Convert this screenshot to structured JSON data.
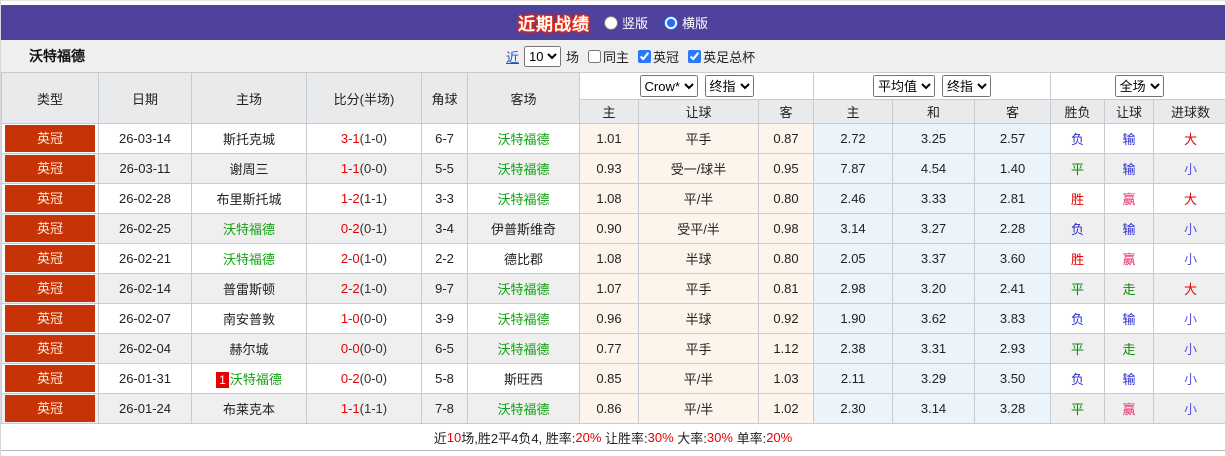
{
  "title_bar": {
    "title": "近期战绩",
    "radio_vertical_label": "竖版",
    "radio_horizontal_label": "横版",
    "selected_layout": "横版"
  },
  "team_bar": {
    "team": "沃特福德",
    "near_label": "近",
    "match_count": "10",
    "unit_label": "场",
    "checkbox_same_home": {
      "label": "同主",
      "checked": false
    },
    "checkbox_league": {
      "label": "英冠",
      "checked": true
    },
    "checkbox_cup": {
      "label": "英足总杯",
      "checked": true
    }
  },
  "table": {
    "headers": {
      "type": "类型",
      "date": "日期",
      "home": "主场",
      "score": "比分(半场)",
      "corners": "角球",
      "away": "客场"
    },
    "selects": {
      "odds_company": "Crow*",
      "final_odds_1": "终指",
      "average": "平均值",
      "final_odds_2": "终指",
      "scope": "全场"
    },
    "sub_headers": {
      "crow_home": "主",
      "crow_handicap": "让球",
      "crow_away": "客",
      "avg_home": "主",
      "avg_draw": "和",
      "avg_away": "客",
      "result_wdl": "胜负",
      "result_handicap": "让球",
      "result_goals": "进球数"
    },
    "rows": [
      {
        "league": "英冠",
        "date": "26-03-14",
        "home": "斯托克城",
        "home_self": false,
        "home_rank": "",
        "score_ft": "3-1",
        "score_ht": "(1-0)",
        "corners": "6-7",
        "away": "沃特福德",
        "away_self": true,
        "crow_home": "1.01",
        "handicap": "平手",
        "crow_away": "0.87",
        "avg_home": "2.72",
        "avg_draw": "3.25",
        "avg_away": "2.57",
        "wdl": "负",
        "wdl_k": "lose",
        "cover": "输",
        "cover_k": "lose",
        "goals": "大",
        "goals_k": "big"
      },
      {
        "league": "英冠",
        "date": "26-03-11",
        "home": "谢周三",
        "home_self": false,
        "home_rank": "",
        "score_ft": "1-1",
        "score_ht": "(0-0)",
        "corners": "5-5",
        "away": "沃特福德",
        "away_self": true,
        "crow_home": "0.93",
        "handicap": "受一/球半",
        "crow_away": "0.95",
        "avg_home": "7.87",
        "avg_draw": "4.54",
        "avg_away": "1.40",
        "wdl": "平",
        "wdl_k": "draw",
        "cover": "输",
        "cover_k": "lose",
        "goals": "小",
        "goals_k": "small"
      },
      {
        "league": "英冠",
        "date": "26-02-28",
        "home": "布里斯托城",
        "home_self": false,
        "home_rank": "",
        "score_ft": "1-2",
        "score_ht": "(1-1)",
        "corners": "3-3",
        "away": "沃特福德",
        "away_self": true,
        "crow_home": "1.08",
        "handicap": "平/半",
        "crow_away": "0.80",
        "avg_home": "2.46",
        "avg_draw": "3.33",
        "avg_away": "2.81",
        "wdl": "胜",
        "wdl_k": "win",
        "cover": "赢",
        "cover_k": "hwin",
        "goals": "大",
        "goals_k": "big"
      },
      {
        "league": "英冠",
        "date": "26-02-25",
        "home": "沃特福德",
        "home_self": true,
        "home_rank": "",
        "score_ft": "0-2",
        "score_ht": "(0-1)",
        "corners": "3-4",
        "away": "伊普斯维奇",
        "away_self": false,
        "crow_home": "0.90",
        "handicap": "受平/半",
        "crow_away": "0.98",
        "avg_home": "3.14",
        "avg_draw": "3.27",
        "avg_away": "2.28",
        "wdl": "负",
        "wdl_k": "lose",
        "cover": "输",
        "cover_k": "lose",
        "goals": "小",
        "goals_k": "small"
      },
      {
        "league": "英冠",
        "date": "26-02-21",
        "home": "沃特福德",
        "home_self": true,
        "home_rank": "",
        "score_ft": "2-0",
        "score_ht": "(1-0)",
        "corners": "2-2",
        "away": "德比郡",
        "away_self": false,
        "crow_home": "1.08",
        "handicap": "半球",
        "crow_away": "0.80",
        "avg_home": "2.05",
        "avg_draw": "3.37",
        "avg_away": "3.60",
        "wdl": "胜",
        "wdl_k": "win",
        "cover": "赢",
        "cover_k": "hwin",
        "goals": "小",
        "goals_k": "small"
      },
      {
        "league": "英冠",
        "date": "26-02-14",
        "home": "普雷斯顿",
        "home_self": false,
        "home_rank": "",
        "score_ft": "2-2",
        "score_ht": "(1-0)",
        "corners": "9-7",
        "away": "沃特福德",
        "away_self": true,
        "crow_home": "1.07",
        "handicap": "平手",
        "crow_away": "0.81",
        "avg_home": "2.98",
        "avg_draw": "3.20",
        "avg_away": "2.41",
        "wdl": "平",
        "wdl_k": "draw",
        "cover": "走",
        "cover_k": "draw",
        "goals": "大",
        "goals_k": "big"
      },
      {
        "league": "英冠",
        "date": "26-02-07",
        "home": "南安普敦",
        "home_self": false,
        "home_rank": "",
        "score_ft": "1-0",
        "score_ht": "(0-0)",
        "corners": "3-9",
        "away": "沃特福德",
        "away_self": true,
        "crow_home": "0.96",
        "handicap": "半球",
        "crow_away": "0.92",
        "avg_home": "1.90",
        "avg_draw": "3.62",
        "avg_away": "3.83",
        "wdl": "负",
        "wdl_k": "lose",
        "cover": "输",
        "cover_k": "lose",
        "goals": "小",
        "goals_k": "small"
      },
      {
        "league": "英冠",
        "date": "26-02-04",
        "home": "赫尔城",
        "home_self": false,
        "home_rank": "",
        "score_ft": "0-0",
        "score_ht": "(0-0)",
        "corners": "6-5",
        "away": "沃特福德",
        "away_self": true,
        "crow_home": "0.77",
        "handicap": "平手",
        "crow_away": "1.12",
        "avg_home": "2.38",
        "avg_draw": "3.31",
        "avg_away": "2.93",
        "wdl": "平",
        "wdl_k": "draw",
        "cover": "走",
        "cover_k": "draw",
        "goals": "小",
        "goals_k": "small"
      },
      {
        "league": "英冠",
        "date": "26-01-31",
        "home": "沃特福德",
        "home_self": true,
        "home_rank": "1",
        "score_ft": "0-2",
        "score_ht": "(0-0)",
        "corners": "5-8",
        "away": "斯旺西",
        "away_self": false,
        "crow_home": "0.85",
        "handicap": "平/半",
        "crow_away": "1.03",
        "avg_home": "2.11",
        "avg_draw": "3.29",
        "avg_away": "3.50",
        "wdl": "负",
        "wdl_k": "lose",
        "cover": "输",
        "cover_k": "lose",
        "goals": "小",
        "goals_k": "small"
      },
      {
        "league": "英冠",
        "date": "26-01-24",
        "home": "布莱克本",
        "home_self": false,
        "home_rank": "",
        "score_ft": "1-1",
        "score_ht": "(1-1)",
        "corners": "7-8",
        "away": "沃特福德",
        "away_self": true,
        "crow_home": "0.86",
        "handicap": "平/半",
        "crow_away": "1.02",
        "avg_home": "2.30",
        "avg_draw": "3.14",
        "avg_away": "3.28",
        "wdl": "平",
        "wdl_k": "draw",
        "cover": "赢",
        "cover_k": "hwin",
        "goals": "小",
        "goals_k": "small"
      }
    ]
  },
  "footer": {
    "segments": [
      {
        "text": "近",
        "red": false
      },
      {
        "text": "10",
        "red": true
      },
      {
        "text": "场,胜2平4负4, 胜率:",
        "red": false
      },
      {
        "text": "20%",
        "red": true
      },
      {
        "text": " 让胜率:",
        "red": false
      },
      {
        "text": "30%",
        "red": true
      },
      {
        "text": " 大率:",
        "red": false
      },
      {
        "text": "30%",
        "red": true
      },
      {
        "text": " 单率:",
        "red": false
      },
      {
        "text": "20%",
        "red": true
      }
    ]
  },
  "colors": {
    "header_purple": "#4e429c",
    "badge_red": "#c63306",
    "self_team_green": "#13a113",
    "win_red": "#e60000",
    "draw_green": "#0a8a0a",
    "lose_blue": "#2a2ad0",
    "handicap_win_pink": "#ef2d6a",
    "goals_small_blue": "#5a55dd",
    "crow_columns_bg": "#fdf5ec",
    "avg_columns_bg": "#eaf4fa"
  }
}
